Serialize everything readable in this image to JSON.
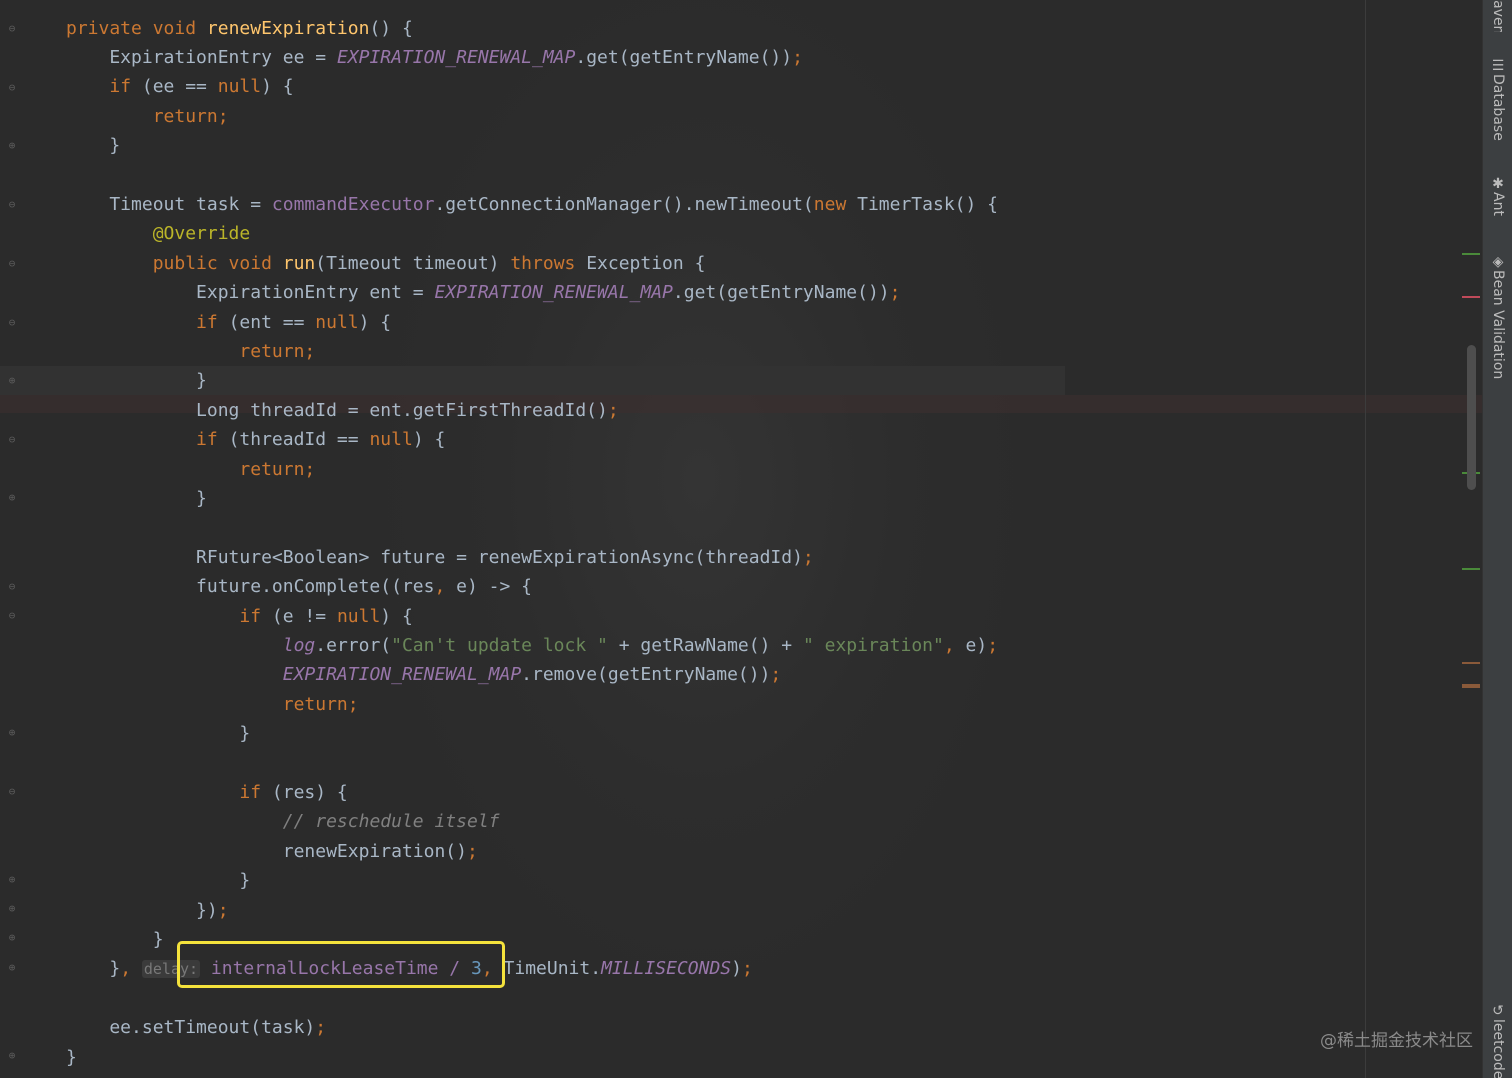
{
  "editor": {
    "lines": [
      [
        {
          "t": "private void ",
          "c": "k"
        },
        {
          "t": "renewExpiration",
          "c": "fn"
        },
        {
          "t": "() {"
        }
      ],
      [
        {
          "t": "    ExpirationEntry ee = "
        },
        {
          "t": "EXPIRATION_RENEWAL_MAP",
          "c": "st"
        },
        {
          "t": ".get(getEntryName())"
        },
        {
          "t": ";",
          "c": "k"
        }
      ],
      [
        {
          "t": "    "
        },
        {
          "t": "if ",
          "c": "k"
        },
        {
          "t": "(ee == "
        },
        {
          "t": "null",
          "c": "k"
        },
        {
          "t": ") {"
        }
      ],
      [
        {
          "t": "        "
        },
        {
          "t": "return;",
          "c": "k"
        }
      ],
      [
        {
          "t": "    }"
        }
      ],
      [],
      [
        {
          "t": "    Timeout task = "
        },
        {
          "t": "commandExecutor",
          "c": "fld"
        },
        {
          "t": ".getConnectionManager().newTimeout("
        },
        {
          "t": "new ",
          "c": "k"
        },
        {
          "t": "TimerTask() {"
        }
      ],
      [
        {
          "t": "        "
        },
        {
          "t": "@Override",
          "c": "an"
        }
      ],
      [
        {
          "t": "        "
        },
        {
          "t": "public void ",
          "c": "k"
        },
        {
          "t": "run",
          "c": "fn"
        },
        {
          "t": "(Timeout timeout) "
        },
        {
          "t": "throws ",
          "c": "k"
        },
        {
          "t": "Exception {"
        }
      ],
      [
        {
          "t": "            ExpirationEntry ent = "
        },
        {
          "t": "EXPIRATION_RENEWAL_MAP",
          "c": "st"
        },
        {
          "t": ".get(getEntryName())"
        },
        {
          "t": ";",
          "c": "k"
        }
      ],
      [
        {
          "t": "            "
        },
        {
          "t": "if ",
          "c": "k"
        },
        {
          "t": "(ent == "
        },
        {
          "t": "null",
          "c": "k"
        },
        {
          "t": ") {"
        }
      ],
      [
        {
          "t": "                "
        },
        {
          "t": "return;",
          "c": "k"
        }
      ],
      [
        {
          "t": "            }"
        }
      ],
      [
        {
          "t": "            Long threadId = ent.getFirstThreadId()"
        },
        {
          "t": ";",
          "c": "k"
        }
      ],
      [
        {
          "t": "            "
        },
        {
          "t": "if ",
          "c": "k"
        },
        {
          "t": "(threadId == "
        },
        {
          "t": "null",
          "c": "k"
        },
        {
          "t": ") {"
        }
      ],
      [
        {
          "t": "                "
        },
        {
          "t": "return;",
          "c": "k"
        }
      ],
      [
        {
          "t": "            }"
        }
      ],
      [],
      [
        {
          "t": "            RFuture<Boolean> future = renewExpirationAsync(threadId)"
        },
        {
          "t": ";",
          "c": "k"
        }
      ],
      [
        {
          "t": "            future.onComplete((res"
        },
        {
          "t": ", ",
          "c": "k"
        },
        {
          "t": "e) -> {"
        }
      ],
      [
        {
          "t": "                "
        },
        {
          "t": "if ",
          "c": "k"
        },
        {
          "t": "(e != "
        },
        {
          "t": "null",
          "c": "k"
        },
        {
          "t": ") {"
        }
      ],
      [
        {
          "t": "                    "
        },
        {
          "t": "log",
          "c": "st"
        },
        {
          "t": ".error("
        },
        {
          "t": "\"Can't update lock \"",
          "c": "str"
        },
        {
          "t": " + getRawName() + "
        },
        {
          "t": "\" expiration\"",
          "c": "str"
        },
        {
          "t": ", ",
          "c": "k"
        },
        {
          "t": "e)"
        },
        {
          "t": ";",
          "c": "k"
        }
      ],
      [
        {
          "t": "                    "
        },
        {
          "t": "EXPIRATION_RENEWAL_MAP",
          "c": "st"
        },
        {
          "t": ".remove(getEntryName())"
        },
        {
          "t": ";",
          "c": "k"
        }
      ],
      [
        {
          "t": "                    "
        },
        {
          "t": "return;",
          "c": "k"
        }
      ],
      [
        {
          "t": "                }"
        }
      ],
      [],
      [
        {
          "t": "                "
        },
        {
          "t": "if ",
          "c": "k"
        },
        {
          "t": "(res) {"
        }
      ],
      [
        {
          "t": "                    "
        },
        {
          "t": "// reschedule itself",
          "c": "cm"
        }
      ],
      [
        {
          "t": "                    renewExpiration()"
        },
        {
          "t": ";",
          "c": "k"
        }
      ],
      [
        {
          "t": "                }"
        }
      ],
      [
        {
          "t": "            })"
        },
        {
          "t": ";",
          "c": "k"
        }
      ],
      [
        {
          "t": "        }"
        }
      ],
      [
        {
          "t": "    }"
        },
        {
          "t": ", ",
          "c": "k"
        },
        {
          "t": "delay:",
          "c": "hint"
        },
        {
          "t": " internalLockLeaseTime / ",
          "c": "fld"
        },
        {
          "t": "3",
          "c": "num"
        },
        {
          "t": ", ",
          "c": "k"
        },
        {
          "t": "TimeUnit."
        },
        {
          "t": "MILLISECONDS",
          "c": "st"
        },
        {
          "t": ")"
        },
        {
          "t": ";",
          "c": "k"
        }
      ],
      [],
      [
        {
          "t": "    ee.setTimeout(task)"
        },
        {
          "t": ";",
          "c": "k"
        }
      ],
      [
        {
          "t": "}"
        }
      ]
    ]
  },
  "toolstrip": {
    "maven_label": "Maven",
    "database_label": "Database",
    "ant_label": "Ant",
    "bean_validation_label": "Bean Validation",
    "leetcode_label": "leetcode"
  },
  "watermark": "@稀土掘金技术社区",
  "colors": {
    "background": "#2b2b2b",
    "keyword": "#cc7832",
    "method": "#ffc66d",
    "static_field": "#9876aa",
    "annotation": "#bbb529",
    "string": "#6a8759",
    "number": "#6897bb",
    "highlight_box": "#f4e23c"
  },
  "icons": {
    "fold_open": "fold-open-icon",
    "fold_close": "fold-close-icon",
    "database": "database-icon",
    "ant": "ant-icon",
    "bean_validation": "bean-validation-icon",
    "leetcode": "leetcode-icon"
  }
}
